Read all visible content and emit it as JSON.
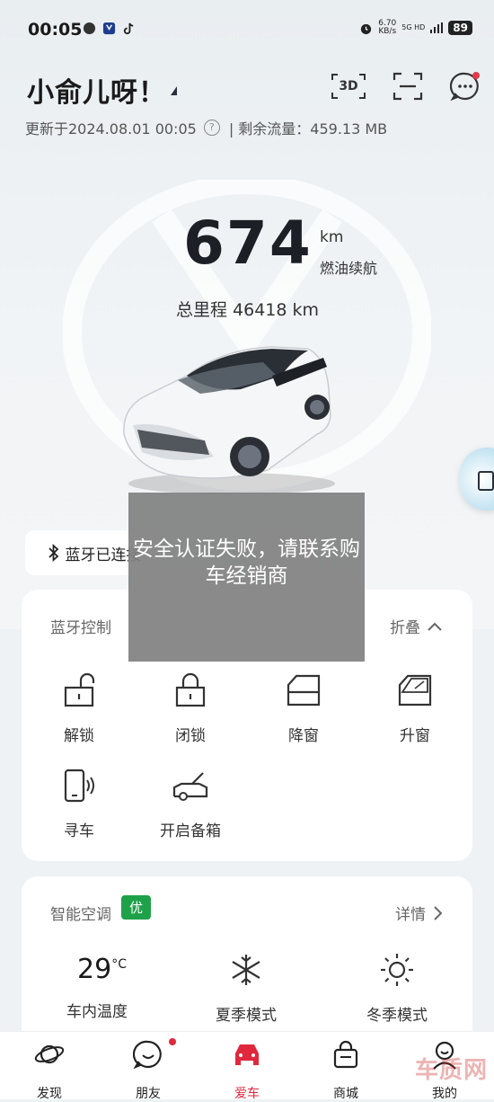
{
  "status_bar": {
    "time": "00:05",
    "net_speed_value": "6.70",
    "net_speed_unit": "KB/s",
    "signal": "5G HD",
    "battery": "89"
  },
  "header": {
    "title": "小俞儿呀！",
    "btn_3d": "3D",
    "update_text": "更新于2024.08.01 00:05",
    "help": "?",
    "remaining_data": "| 剩余流量：459.13 MB"
  },
  "range": {
    "value": "674",
    "unit": "km",
    "label": "燃油续航",
    "odometer": "总里程 46418 km"
  },
  "bluetooth": {
    "status": "蓝牙已连接"
  },
  "toast": {
    "message": "安全认证失败，请联系购车经销商"
  },
  "bt_control": {
    "title": "蓝牙控制",
    "collapse": "折叠",
    "items": [
      {
        "label": "解锁",
        "icon": "unlock-icon"
      },
      {
        "label": "闭锁",
        "icon": "lock-icon"
      },
      {
        "label": "降窗",
        "icon": "window-down-icon"
      },
      {
        "label": "升窗",
        "icon": "window-up-icon"
      },
      {
        "label": "寻车",
        "icon": "find-car-icon"
      },
      {
        "label": "开启备箱",
        "icon": "trunk-icon"
      }
    ]
  },
  "climate": {
    "title": "智能空调",
    "badge": "优",
    "details": "详情",
    "temp": "29",
    "temp_unit": "°C",
    "temp_label": "车内温度",
    "summary": "夏季模式",
    "winter": "冬季模式"
  },
  "nav": {
    "items": [
      {
        "label": "发现",
        "icon": "planet-icon"
      },
      {
        "label": "朋友",
        "icon": "chat-icon"
      },
      {
        "label": "爱车",
        "icon": "car-icon"
      },
      {
        "label": "商城",
        "icon": "shop-icon"
      },
      {
        "label": "我的",
        "icon": "profile-icon"
      }
    ]
  },
  "watermark": "车质网",
  "colors": {
    "accent": "#e0283c",
    "badge_green": "#1fa14a"
  }
}
